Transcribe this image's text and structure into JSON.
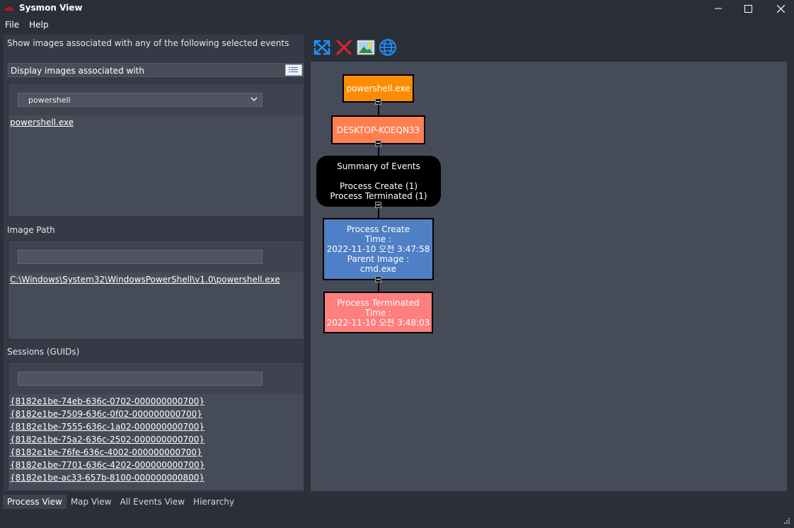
{
  "window": {
    "title": "Sysmon View"
  },
  "menu": [
    "File",
    "Help"
  ],
  "left_panel": {
    "instruction": "Show images associated with any of the following selected events",
    "display_label": "Display images associated with",
    "image_group": {
      "selected": "powershell",
      "items": [
        "powershell.exe"
      ]
    },
    "image_path": {
      "label": "Image Path",
      "items": [
        "C:\\Windows\\System32\\WindowsPowerShell\\v1.0\\powershell.exe"
      ]
    },
    "sessions": {
      "label": "Sessions (GUIDs)",
      "items": [
        "{8182e1be-74eb-636c-0702-000000000700}",
        "{8182e1be-7509-636c-0f02-000000000700}",
        "{8182e1be-7555-636c-1a02-000000000700}",
        "{8182e1be-75a2-636c-2502-000000000700}",
        "{8182e1be-76fe-636c-4002-000000000700}",
        "{8182e1be-7701-636c-4202-000000000700}",
        "{8182e1be-ac33-657b-8100-000000000800}"
      ]
    }
  },
  "tabs": [
    "Process View",
    "Map View",
    "All Events View",
    "Hierarchy"
  ],
  "toolbar_icons": [
    "fit-view-icon",
    "clear-icon",
    "export-image-icon",
    "map-globe-icon"
  ],
  "graph": {
    "nodes": [
      {
        "lines": [
          "powershell.exe"
        ],
        "color": "#ff8c00"
      },
      {
        "lines": [
          "DESKTOP-KOEQN33"
        ],
        "color": "#ff7f50"
      },
      {
        "lines": [
          "Summary of Events",
          "",
          "Process Create (1)",
          "Process Terminated (1)"
        ],
        "color": "#000000"
      },
      {
        "lines": [
          "Process Create",
          "Time :",
          "2022-11-10 오전 3:47:58",
          "Parent Image :",
          "cmd.exe"
        ],
        "color": "#4f7fc4"
      },
      {
        "lines": [
          "Process Terminated",
          "Time :",
          "2022-11-10 오전 3:48:03"
        ],
        "color": "#ff7f7f"
      }
    ]
  }
}
